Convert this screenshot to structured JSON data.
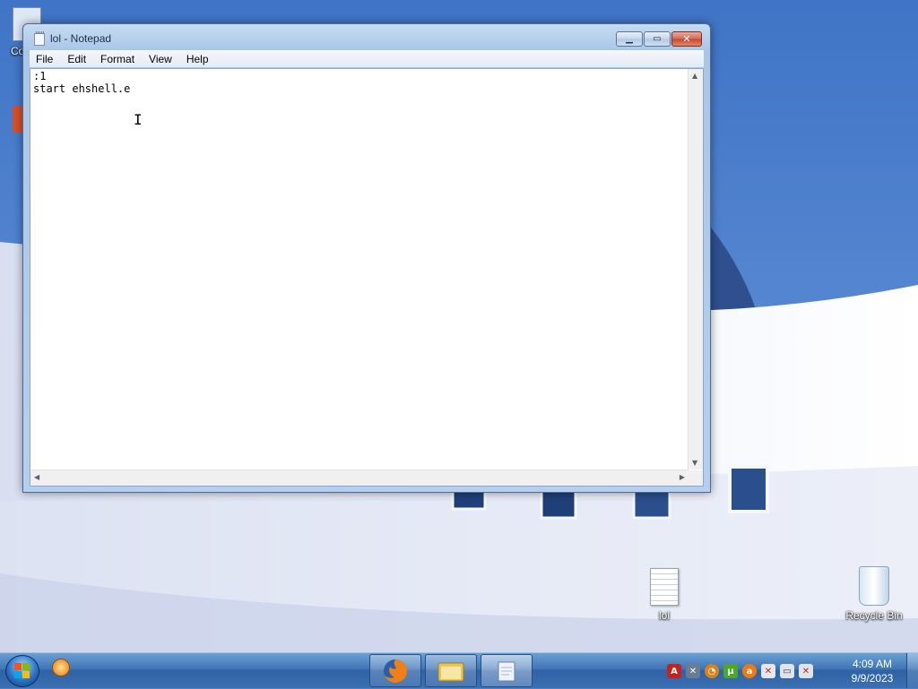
{
  "window": {
    "title": "lol - Notepad",
    "min_glyph": "▁",
    "max_glyph": "▭",
    "close_glyph": "✕"
  },
  "menu": {
    "file": "File",
    "edit": "Edit",
    "format": "Format",
    "view": "View",
    "help": "Help"
  },
  "editor": {
    "text": ":1\nstart ehshell.e"
  },
  "desktop": {
    "icons": {
      "lol_file": "lol",
      "recycle_bin": "Recycle Bin",
      "computer_partial": "Co"
    }
  },
  "taskbar": {
    "pinned": [
      "firefox-icon",
      "explorer-folder-icon",
      "notepad-icon"
    ],
    "tray": [
      "acrobat-icon",
      "tools-icon",
      "search-icon",
      "utorrent-icon",
      "avast-icon",
      "flag-icon",
      "network-icon",
      "volume-muted-icon"
    ]
  },
  "clock": {
    "time": "4:09 AM",
    "date": "9/9/2023"
  }
}
